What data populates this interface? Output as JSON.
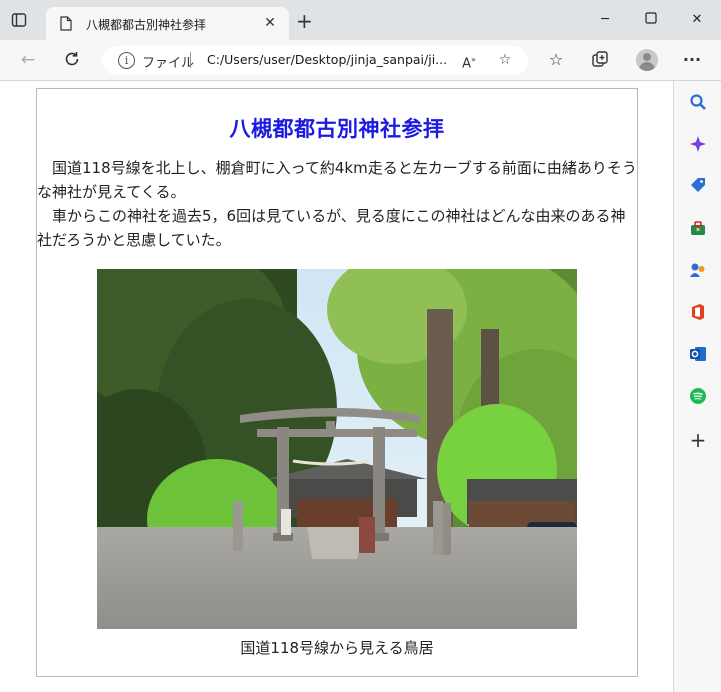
{
  "browser": {
    "tab_title": "八槻都都古別神社参拝",
    "address": {
      "scheme_label": "ファイル",
      "url": "C:/Users/user/Desktop/jinja_sanpai/ji..."
    }
  },
  "page": {
    "title": "八槻都都古別神社参拝",
    "paragraphs": [
      "　国道118号線を北上し、棚倉町に入って約4km走ると左カーブする前面に由緒ありそうな神社が見えてくる。",
      "　車からこの神社を過去5，6回は見ているが、見る度にこの神社はどんな由来のある神社だろうかと思慮していた。"
    ],
    "photo_caption": "国道118号線から見える鳥居"
  },
  "colors": {
    "title_blue": "#1a1ae0",
    "chrome_bg": "#f7f7f7",
    "titlebar_bg": "#dfe3e6"
  },
  "icons": [
    "tab-actions-icon",
    "document-icon",
    "close-icon",
    "new-tab-icon",
    "minimize-icon",
    "maximize-icon",
    "close-window-icon",
    "back-icon",
    "refresh-icon",
    "info-icon",
    "read-aloud-icon",
    "add-favorite-icon",
    "favorites-icon",
    "collections-icon",
    "profile-avatar",
    "more-icon",
    "search-icon",
    "copilot-icon",
    "shopping-icon",
    "tools-icon",
    "games-icon",
    "office-icon",
    "outlook-icon",
    "spotify-icon",
    "add-icon"
  ]
}
